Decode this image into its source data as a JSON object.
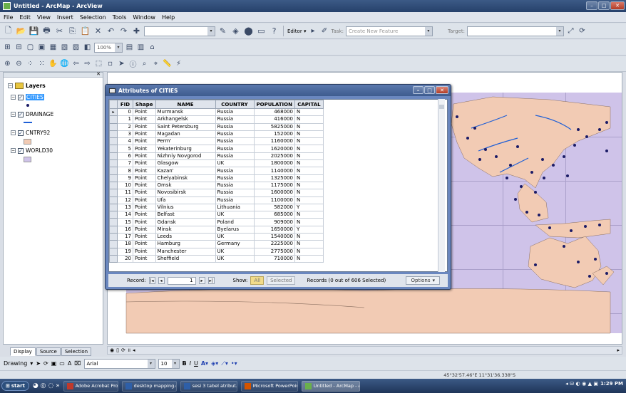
{
  "titlebar": {
    "title": "Untitled - ArcMap - ArcView",
    "btns": [
      "–",
      "□",
      "✕"
    ]
  },
  "menu": [
    "File",
    "Edit",
    "View",
    "Insert",
    "Selection",
    "Tools",
    "Window",
    "Help"
  ],
  "toolbar": {
    "editor_label": "Editor ▾",
    "task_label": "Task:",
    "task_value": "Create New Feature",
    "target_label": "Target:",
    "zoom": "100%"
  },
  "toc": {
    "root": "Layers",
    "layers": [
      "CITIES",
      "DRAINAGE",
      "CNTRY92",
      "WORLD30"
    ],
    "tabs": [
      "Display",
      "Source",
      "Selection"
    ]
  },
  "attr": {
    "title": "Attributes of CITIES",
    "columns": [
      "FID",
      "Shape",
      "NAME",
      "COUNTRY",
      "POPULATION",
      "CAPITAL"
    ],
    "rows": [
      [
        "0",
        "Point",
        "Murmansk",
        "Russia",
        "468000",
        "N"
      ],
      [
        "1",
        "Point",
        "Arkhangelsk",
        "Russia",
        "416000",
        "N"
      ],
      [
        "2",
        "Point",
        "Saint Petersburg",
        "Russia",
        "5825000",
        "N"
      ],
      [
        "3",
        "Point",
        "Magadan",
        "Russia",
        "152000",
        "N"
      ],
      [
        "4",
        "Point",
        "Perm'",
        "Russia",
        "1160000",
        "N"
      ],
      [
        "5",
        "Point",
        "Yekaterinburg",
        "Russia",
        "1620000",
        "N"
      ],
      [
        "6",
        "Point",
        "Nizhniy Novgorod",
        "Russia",
        "2025000",
        "N"
      ],
      [
        "7",
        "Point",
        "Glasgow",
        "UK",
        "1800000",
        "N"
      ],
      [
        "8",
        "Point",
        "Kazan'",
        "Russia",
        "1140000",
        "N"
      ],
      [
        "9",
        "Point",
        "Chelyabinsk",
        "Russia",
        "1325000",
        "N"
      ],
      [
        "10",
        "Point",
        "Omsk",
        "Russia",
        "1175000",
        "N"
      ],
      [
        "11",
        "Point",
        "Novosibirsk",
        "Russia",
        "1600000",
        "N"
      ],
      [
        "12",
        "Point",
        "Ufa",
        "Russia",
        "1100000",
        "N"
      ],
      [
        "13",
        "Point",
        "Vilnius",
        "Lithuania",
        "582000",
        "Y"
      ],
      [
        "14",
        "Point",
        "Belfast",
        "UK",
        "685000",
        "N"
      ],
      [
        "15",
        "Point",
        "Gdansk",
        "Poland",
        "909000",
        "N"
      ],
      [
        "16",
        "Point",
        "Minsk",
        "Byelarus",
        "1650000",
        "Y"
      ],
      [
        "17",
        "Point",
        "Leeds",
        "UK",
        "1540000",
        "N"
      ],
      [
        "18",
        "Point",
        "Hamburg",
        "Germany",
        "2225000",
        "N"
      ],
      [
        "19",
        "Point",
        "Manchester",
        "UK",
        "2775000",
        "N"
      ],
      [
        "20",
        "Point",
        "Sheffield",
        "UK",
        "710000",
        "N"
      ]
    ],
    "footer": {
      "record_label": "Record:",
      "record_value": "1",
      "show_label": "Show:",
      "all_label": "All",
      "selected_label": "Selected",
      "records_text": "Records (0 out of 606 Selected)",
      "options_label": "Options"
    }
  },
  "drawbar": {
    "drawing_label": "Drawing",
    "font": "Arial",
    "size": "10"
  },
  "status": {
    "coords": "45°32'57.46\"E  11°31'36.338\"S"
  },
  "taskbar": {
    "start": "start",
    "items": [
      "Adobe Acrobat Professi...",
      "desktop mapping.doc -...",
      "sesi 3 tabel atribut.doc...",
      "Microsoft PowerPoint -...",
      "Untitled - ArcMap - Ar..."
    ],
    "time": "1:29 PM"
  },
  "colors": {
    "map_frame": "#cfc3e9",
    "land": "#f2cbb4",
    "rivers": "#1f5fd6",
    "cities": "#1b1b66"
  }
}
